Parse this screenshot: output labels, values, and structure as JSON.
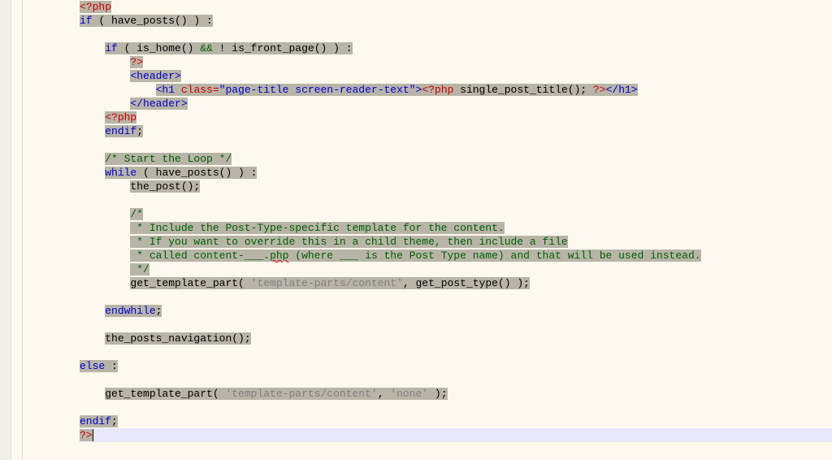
{
  "lines": {
    "l1": {
      "t1": "<?php"
    },
    "l2": {
      "t1": "if",
      "t2": " ( ",
      "t3": "have_posts",
      "t4": "() ) :"
    },
    "l3": {},
    "l4": {
      "t1": "if",
      "t2": " ( ",
      "t3": "is_home",
      "t4": "() ",
      "t5": "&&",
      "t6": " ! ",
      "t7": "is_front_page",
      "t8": "() ) :"
    },
    "l5": {
      "t1": "?>"
    },
    "l6": {
      "t1": "<header>"
    },
    "l7": {
      "t1": "<h1 ",
      "t2": "class=",
      "t3": "\"page-title screen-reader-text\"",
      "t4": ">",
      "t5": "<?php",
      "t6": " ",
      "t7": "single_post_title",
      "t8": "(); ",
      "t9": "?>",
      "t10": "</h1>"
    },
    "l8": {
      "t1": "</header>"
    },
    "l9": {
      "t1": "<?php"
    },
    "l10": {
      "t1": "endif",
      "t2": ";"
    },
    "l11": {},
    "l12": {
      "t1": "/* Start the Loop */"
    },
    "l13": {
      "t1": "while",
      "t2": " ( ",
      "t3": "have_posts",
      "t4": "() ) :"
    },
    "l14": {
      "t1": "the_post",
      "t2": "();"
    },
    "l15": {},
    "l16": {
      "t1": "/*"
    },
    "l17": {
      "t1": " * Include the Post-Type-specific template for the content."
    },
    "l18": {
      "t1": " * If you want to override this in a child theme, then include a file"
    },
    "l19": {
      "t1": " * called content-___.",
      "t2": "php",
      "t3": " (where ___ is the Post Type name) and that will be used instead."
    },
    "l20": {
      "t1": " */"
    },
    "l21": {
      "t1": "get_template_part",
      "t2": "( ",
      "t3": "'template-parts/content'",
      "t4": ", ",
      "t5": "get_post_type",
      "t6": "() );"
    },
    "l22": {},
    "l23": {
      "t1": "endwhile",
      "t2": ";"
    },
    "l24": {},
    "l25": {
      "t1": "the_posts_navigation",
      "t2": "();"
    },
    "l26": {},
    "l27": {
      "t1": "else",
      "t2": " :"
    },
    "l28": {},
    "l29": {
      "t1": "get_template_part",
      "t2": "( ",
      "t3": "'template-parts/content'",
      "t4": ", ",
      "t5": "'none'",
      "t6": " );"
    },
    "l30": {},
    "l31": {
      "t1": "endif",
      "t2": ";"
    },
    "l32": {
      "t1": "?>"
    }
  },
  "indent": {
    "i1": "    ",
    "i2": "        ",
    "i3": "            ",
    "i4": "                "
  }
}
